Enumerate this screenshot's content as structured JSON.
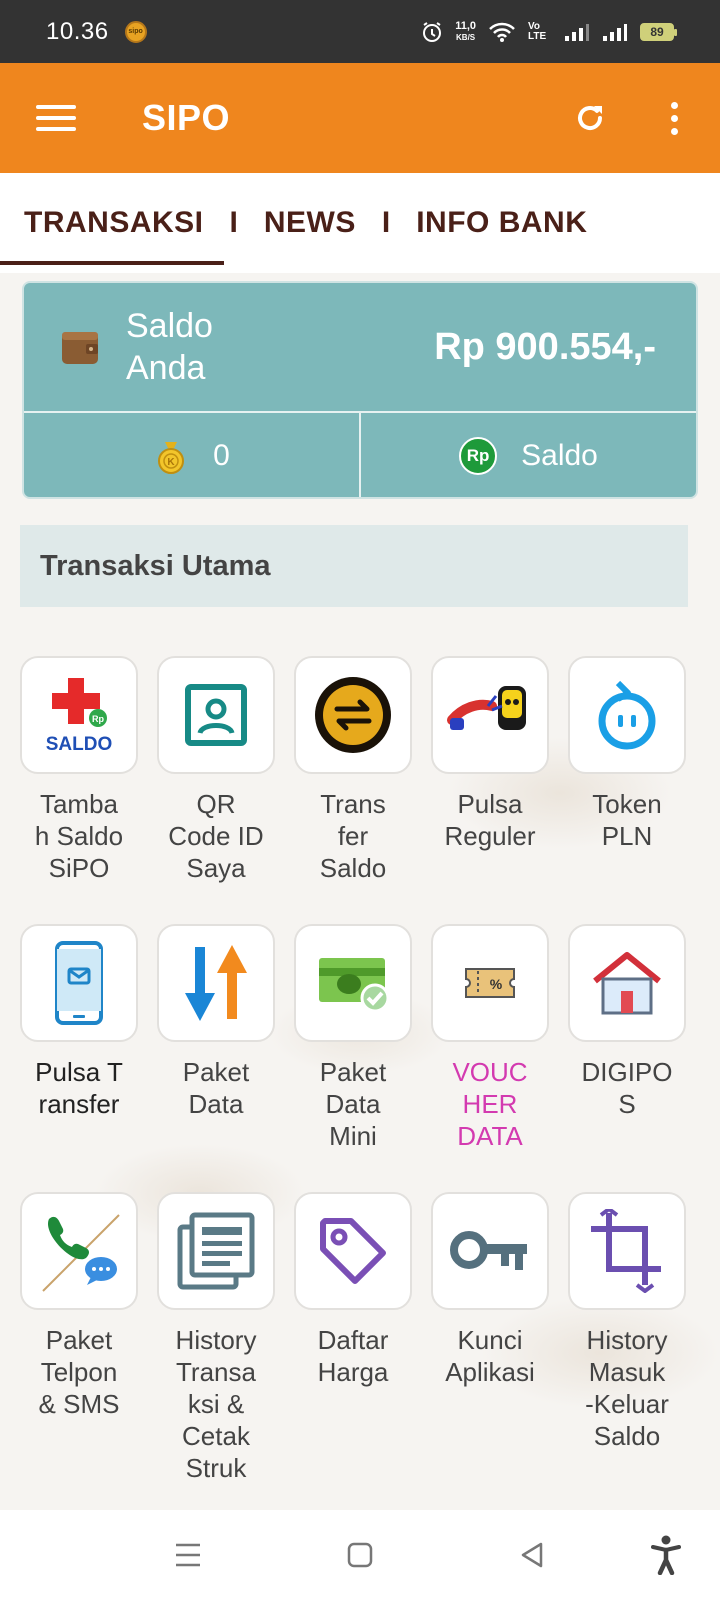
{
  "status_bar": {
    "time": "10.36",
    "app_badge": "sipo",
    "speed_value": "11,0",
    "speed_unit": "KB/S",
    "volte": "Vo LTE",
    "battery": "89"
  },
  "app_bar": {
    "menu_icon": "hamburger-icon",
    "title": "SIPO",
    "refresh_icon": "refresh-icon",
    "more_icon": "more-vertical-icon"
  },
  "tabs": [
    {
      "label": "TRANSAKSI",
      "active": true
    },
    {
      "label": "NEWS",
      "active": false
    },
    {
      "label": "INFO BANK",
      "active": false
    }
  ],
  "tab_separator": "I",
  "balance": {
    "label": "Saldo Anda",
    "value": "Rp 900.554,-",
    "points": "0",
    "saldo_button": "Saldo",
    "rp_badge": "Rp"
  },
  "section": {
    "title": "Transaksi Utama"
  },
  "menu": [
    {
      "label": "Tamba h Saldo SiPO",
      "icon": "add-saldo-icon",
      "color": ""
    },
    {
      "label": "QR Code ID Saya",
      "icon": "qr-id-icon",
      "color": ""
    },
    {
      "label": "Trans fer Saldo",
      "icon": "transfer-coin-icon",
      "color": ""
    },
    {
      "label": "Pulsa Reguler",
      "icon": "pulsa-reguler-icon",
      "color": ""
    },
    {
      "label": "Token PLN",
      "icon": "token-pln-icon",
      "color": ""
    },
    {
      "label": "Pulsa T ransfer",
      "icon": "pulsa-transfer-icon",
      "color": "dark"
    },
    {
      "label": "Paket Data",
      "icon": "up-down-arrows-icon",
      "color": ""
    },
    {
      "label": "Paket Data Mini",
      "icon": "data-mini-icon",
      "color": ""
    },
    {
      "label": "VOUC HER DATA",
      "icon": "voucher-icon",
      "color": "pink"
    },
    {
      "label": "DIGIPO S",
      "icon": "house-icon",
      "color": ""
    },
    {
      "label": "Paket Telpon & SMS",
      "icon": "phone-sms-icon",
      "color": ""
    },
    {
      "label": "History Transa ksi & Cetak Struk",
      "icon": "history-doc-icon",
      "color": ""
    },
    {
      "label": "Daftar Harga",
      "icon": "price-tag-icon",
      "color": ""
    },
    {
      "label": "Kunci Aplikasi",
      "icon": "key-icon",
      "color": ""
    },
    {
      "label": "History Masuk -Keluar Saldo",
      "icon": "crop-icon",
      "color": ""
    }
  ],
  "menu_lines": [
    [
      "Tamba",
      "h Saldo",
      "SiPO"
    ],
    [
      "QR",
      "Code ID",
      "Saya"
    ],
    [
      "Trans",
      "fer",
      "Saldo"
    ],
    [
      "Pulsa",
      "Reguler"
    ],
    [
      "Token",
      "PLN"
    ],
    [
      "Pulsa T",
      "ransfer"
    ],
    [
      "Paket",
      "Data"
    ],
    [
      "Paket",
      "Data",
      "Mini"
    ],
    [
      "VOUC",
      "HER",
      "DATA"
    ],
    [
      "DIGIPO",
      "S"
    ],
    [
      "Paket",
      "Telpon",
      "& SMS"
    ],
    [
      "History",
      "Transa",
      "ksi &",
      "Cetak",
      "Struk"
    ],
    [
      "Daftar",
      "Harga"
    ],
    [
      "Kunci",
      "Aplikasi"
    ],
    [
      "History",
      "Masuk",
      "-Keluar",
      "Saldo"
    ]
  ],
  "nav_bar": {
    "recents_icon": "recents-icon",
    "home_icon": "home-icon",
    "back_icon": "back-icon",
    "accessibility_icon": "accessibility-icon"
  },
  "colors": {
    "app_bar": "#ef861e",
    "tab_text": "#4a2018",
    "balance_card": "#7db8ba",
    "voucher_text": "#d33ab0"
  }
}
